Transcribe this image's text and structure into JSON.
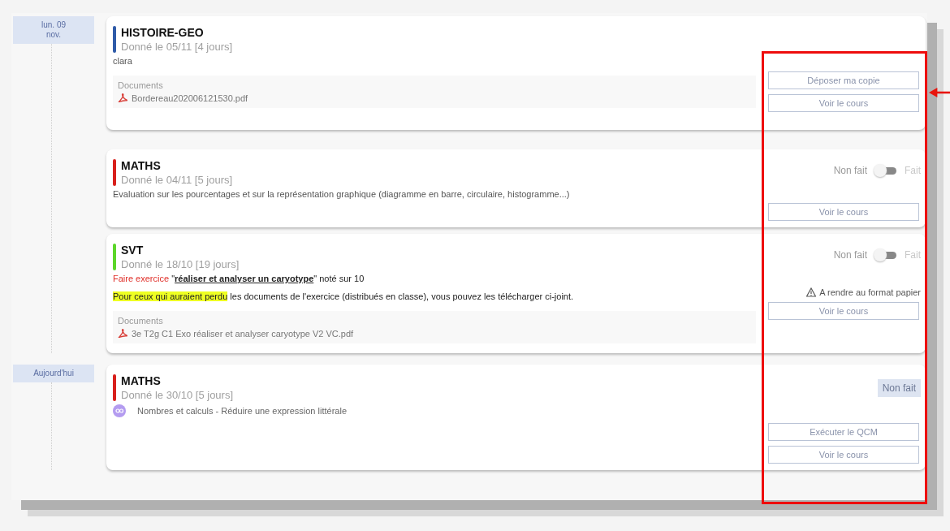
{
  "days": [
    {
      "date": [
        "lun. 09",
        "nov."
      ],
      "tasks": [
        {
          "subject": "HISTOIRE-GEO",
          "color": "#2f5ba8",
          "given": "Donné le 05/11 [4 jours]",
          "paragraphs": [
            [
              {
                "text": "clara",
                "kind": "plain"
              }
            ]
          ],
          "documents": {
            "label": "Documents",
            "files": [
              "Bordereau202006121530.pdf"
            ]
          },
          "actions": [
            {
              "kind": "button",
              "label": "Déposer ma copie"
            },
            {
              "kind": "button",
              "label": "Voir le cours"
            }
          ]
        },
        {
          "subject": "MATHS",
          "color": "#d8201c",
          "given": "Donné le 04/11 [5 jours]",
          "paragraphs": [
            [
              {
                "text": "Evaluation sur les pourcentages et sur la représentation graphique (diagramme en barre, circulaire, histogramme...)",
                "kind": "plain"
              }
            ]
          ],
          "actions": [
            {
              "kind": "toggle",
              "off_label": "Non fait",
              "on_label": "Fait",
              "on": false
            },
            {
              "kind": "button",
              "label": "Voir le cours"
            }
          ]
        },
        {
          "subject": "SVT",
          "color": "#5cd62a",
          "given": "Donné le 18/10 [19 jours]",
          "paragraphs": [
            [
              {
                "text": "Faire exercice ",
                "kind": "red"
              },
              {
                "text": "\"",
                "kind": "dark"
              },
              {
                "text": "réaliser et analyser un caryotype",
                "kind": "emphasis"
              },
              {
                "text": "\" noté sur 10",
                "kind": "dark"
              }
            ],
            [
              {
                "text": "Pour ceux qui auraient perdu",
                "kind": "highlight"
              },
              {
                "text": " les documents de l'exercice (distribués en classe), vous pouvez les télécharger ci-joint.",
                "kind": "dark"
              }
            ]
          ],
          "documents": {
            "label": "Documents",
            "files": [
              "3e T2g C1 Exo réaliser et analyser caryotype V2 VC.pdf"
            ]
          },
          "actions": [
            {
              "kind": "toggle",
              "off_label": "Non fait",
              "on_label": "Fait",
              "on": false
            },
            {
              "kind": "note",
              "text": "A rendre au format papier"
            },
            {
              "kind": "button",
              "label": "Voir le cours"
            }
          ]
        }
      ]
    },
    {
      "date": [
        "Aujourd'hui"
      ],
      "tasks": [
        {
          "subject": "MATHS",
          "color": "#d8201c",
          "given": "Donné le 30/10 [5 jours]",
          "qcm": "Nombres et calculs - Réduire une expression littérale",
          "actions": [
            {
              "kind": "status",
              "text": "Non fait"
            },
            {
              "kind": "button",
              "label": "Exécuter le QCM"
            },
            {
              "kind": "button",
              "label": "Voir le cours"
            }
          ]
        }
      ]
    }
  ]
}
